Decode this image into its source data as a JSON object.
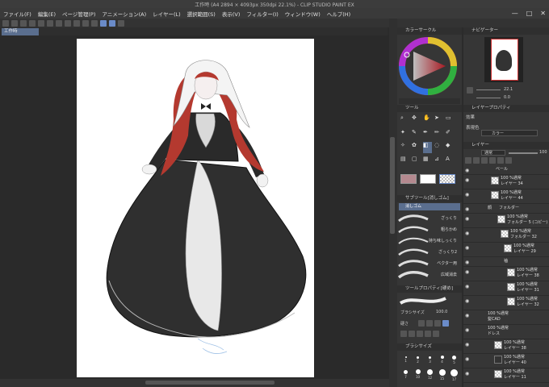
{
  "window": {
    "title": "工作時 (A4 2894 × 4093px 350dpi 22.1%) - CLIP STUDIO PAINT EX"
  },
  "menu": [
    "ファイル(F)",
    "編集(E)",
    "ページ管理(P)",
    "アニメーション(A)",
    "レイヤー(L)",
    "選択範囲(S)",
    "表示(V)",
    "フィルター(I)",
    "ウィンドウ(W)",
    "ヘルプ(H)"
  ],
  "window_controls": [
    "—",
    "□",
    "✕"
  ],
  "document_tab": {
    "label": "工作時"
  },
  "panels": {
    "color_wheel": {
      "title": "カラーサークル"
    },
    "navigator": {
      "title": "ナビゲーター",
      "zoom": "22.1",
      "angle": "0.0"
    },
    "tool": {
      "title": "ツール"
    },
    "layer_property": {
      "title": "レイヤープロパティ",
      "effect_label": "効果",
      "expression_label": "表現色",
      "expression_value": "カラー"
    },
    "sub_tool": {
      "title": "サブツール[消しゴム]",
      "active": "消しゴム"
    },
    "tool_property": {
      "title": "ツールプロパティ[硬め]",
      "size_label": "ブラシサイズ",
      "size_value": "100.0",
      "hardness_label": "硬さ"
    },
    "brush_size": {
      "title": "ブラシサイズ",
      "sizes": [
        "1",
        "2",
        "3",
        "4",
        "5",
        "7",
        "10",
        "12",
        "15",
        "17"
      ]
    },
    "layer": {
      "title": "レイヤー",
      "blend_mode": "通常",
      "opacity": "100"
    }
  },
  "brushes": [
    "ざっくり",
    "粗らかめ",
    "持ち味しっくり",
    "ざっくり2",
    "ベクター用",
    "広域消去"
  ],
  "layers": [
    {
      "name": "ベール",
      "sub": ""
    },
    {
      "name": "100 %通常",
      "sub": "レイヤー 34"
    },
    {
      "name": "100 %通常",
      "sub": "レイヤー 44"
    },
    {
      "name": "顔",
      "sub": "フォルダー"
    },
    {
      "name": "100 %通常",
      "sub": "フォルダー 5 (コピー)"
    },
    {
      "name": "100 %通常",
      "sub": "フォルダー 32"
    },
    {
      "name": "100 %通常",
      "sub": "レイヤー 29"
    },
    {
      "name": "袖",
      "sub": ""
    },
    {
      "name": "100 %通常",
      "sub": "レイヤー 38"
    },
    {
      "name": "100 %通常",
      "sub": "レイヤー 31"
    },
    {
      "name": "100 %通常",
      "sub": "レイヤー 32"
    },
    {
      "name": "100 %通常",
      "sub": "髪CAD"
    },
    {
      "name": "100 %通常",
      "sub": "ドレス"
    },
    {
      "name": "100 %通常",
      "sub": "レイヤー 38"
    },
    {
      "name": "100 %通常",
      "sub": "レイヤー 40"
    },
    {
      "name": "100 %通常",
      "sub": "レイヤー 11"
    }
  ],
  "colors": {
    "main": "#b4898f",
    "sub": "#ffffff",
    "accent": "#6a8bc8"
  }
}
